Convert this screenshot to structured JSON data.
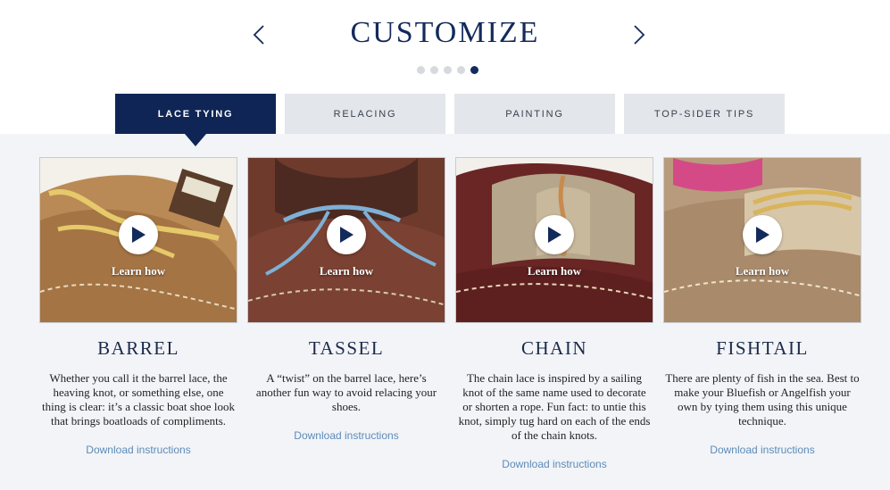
{
  "header": {
    "title": "CUSTOMIZE",
    "prev_icon": "chevron-left-icon",
    "next_icon": "chevron-right-icon",
    "carousel_dots_total": 5,
    "carousel_active_dot": 5
  },
  "tabs": [
    {
      "label": "LACE TYING",
      "active": true
    },
    {
      "label": "RELACING",
      "active": false
    },
    {
      "label": "PAINTING",
      "active": false
    },
    {
      "label": "TOP-SIDER TIPS",
      "active": false
    }
  ],
  "cards": [
    {
      "title": "BARREL",
      "overlay": "Learn how",
      "play_icon": "play-icon",
      "description": "Whether you call it the barrel lace, the heaving knot, or something else, one thing is clear: it’s a classic boat shoe look that brings boatloads of compliments.",
      "link": "Download instructions"
    },
    {
      "title": "TASSEL",
      "overlay": "Learn how",
      "play_icon": "play-icon",
      "description": "A “twist” on the barrel lace, here’s another fun way to avoid relacing your shoes.",
      "link": "Download instructions"
    },
    {
      "title": "CHAIN",
      "overlay": "Learn how",
      "play_icon": "play-icon",
      "description": "The chain lace is inspired by a sailing knot of the same name used to decorate or shorten a rope. Fun fact: to untie this knot, simply tug hard on each of the ends of the chain knots.",
      "link": "Download instructions"
    },
    {
      "title": "FISHTAIL",
      "overlay": "Learn how",
      "play_icon": "play-icon",
      "description": "There are plenty of fish in the sea. Best to make your Bluefish or Angelfish your own by tying them using this unique technique.",
      "link": "Download instructions"
    }
  ],
  "colors": {
    "brand_navy": "#0f2555",
    "tab_inactive": "#e3e6ea",
    "panel_bg": "#f2f4f7",
    "link_blue": "#5d8bb9"
  }
}
